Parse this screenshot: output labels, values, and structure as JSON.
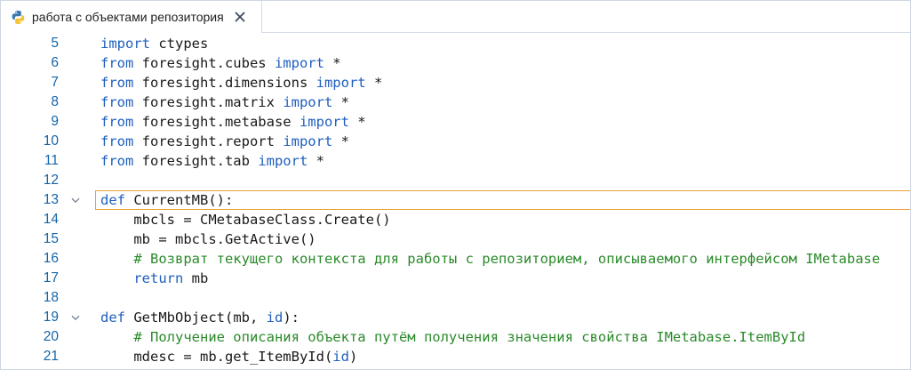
{
  "tab": {
    "title": "работа с объектами репозитория",
    "icon": "python-icon",
    "close_icon": "close-icon"
  },
  "colors": {
    "keyword": "#1f5fbf",
    "comment": "#2a8a2a",
    "line_number": "#1565a8",
    "current_line_border": "#e8a23a"
  },
  "editor": {
    "lines": [
      {
        "num": "5",
        "fold": false,
        "current": false,
        "tokens": [
          {
            "t": "kw",
            "v": "import"
          },
          {
            "t": "tx",
            "v": " ctypes"
          }
        ]
      },
      {
        "num": "6",
        "fold": false,
        "current": false,
        "tokens": [
          {
            "t": "kw",
            "v": "from"
          },
          {
            "t": "tx",
            "v": " foresight.cubes "
          },
          {
            "t": "kw",
            "v": "import"
          },
          {
            "t": "tx",
            "v": " *"
          }
        ]
      },
      {
        "num": "7",
        "fold": false,
        "current": false,
        "tokens": [
          {
            "t": "kw",
            "v": "from"
          },
          {
            "t": "tx",
            "v": " foresight.dimensions "
          },
          {
            "t": "kw",
            "v": "import"
          },
          {
            "t": "tx",
            "v": " *"
          }
        ]
      },
      {
        "num": "8",
        "fold": false,
        "current": false,
        "tokens": [
          {
            "t": "kw",
            "v": "from"
          },
          {
            "t": "tx",
            "v": " foresight.matrix "
          },
          {
            "t": "kw",
            "v": "import"
          },
          {
            "t": "tx",
            "v": " *"
          }
        ]
      },
      {
        "num": "9",
        "fold": false,
        "current": false,
        "tokens": [
          {
            "t": "kw",
            "v": "from"
          },
          {
            "t": "tx",
            "v": " foresight.metabase "
          },
          {
            "t": "kw",
            "v": "import"
          },
          {
            "t": "tx",
            "v": " *"
          }
        ]
      },
      {
        "num": "10",
        "fold": false,
        "current": false,
        "tokens": [
          {
            "t": "kw",
            "v": "from"
          },
          {
            "t": "tx",
            "v": " foresight.report "
          },
          {
            "t": "kw",
            "v": "import"
          },
          {
            "t": "tx",
            "v": " *"
          }
        ]
      },
      {
        "num": "11",
        "fold": false,
        "current": false,
        "tokens": [
          {
            "t": "kw",
            "v": "from"
          },
          {
            "t": "tx",
            "v": " foresight.tab "
          },
          {
            "t": "kw",
            "v": "import"
          },
          {
            "t": "tx",
            "v": " *"
          }
        ]
      },
      {
        "num": "12",
        "fold": false,
        "current": false,
        "tokens": []
      },
      {
        "num": "13",
        "fold": true,
        "current": true,
        "tokens": [
          {
            "t": "kw",
            "v": "def"
          },
          {
            "t": "tx",
            "v": " CurrentMB():"
          }
        ]
      },
      {
        "num": "14",
        "fold": false,
        "current": false,
        "tokens": [
          {
            "t": "tx",
            "v": "    mbcls = CMetabaseClass.Create()"
          }
        ]
      },
      {
        "num": "15",
        "fold": false,
        "current": false,
        "tokens": [
          {
            "t": "tx",
            "v": "    mb = mbcls.GetActive()"
          }
        ]
      },
      {
        "num": "16",
        "fold": false,
        "current": false,
        "tokens": [
          {
            "t": "tx",
            "v": "    "
          },
          {
            "t": "cm",
            "v": "# Возврат текущего контекста для работы с репозиторием, описываемого интерфейсом IMetabase"
          }
        ]
      },
      {
        "num": "17",
        "fold": false,
        "current": false,
        "tokens": [
          {
            "t": "tx",
            "v": "    "
          },
          {
            "t": "kw",
            "v": "return"
          },
          {
            "t": "tx",
            "v": " mb"
          }
        ]
      },
      {
        "num": "18",
        "fold": false,
        "current": false,
        "tokens": []
      },
      {
        "num": "19",
        "fold": true,
        "current": false,
        "tokens": [
          {
            "t": "kw",
            "v": "def"
          },
          {
            "t": "tx",
            "v": " GetMbObject(mb, "
          },
          {
            "t": "id",
            "v": "id"
          },
          {
            "t": "tx",
            "v": "):"
          }
        ]
      },
      {
        "num": "20",
        "fold": false,
        "current": false,
        "tokens": [
          {
            "t": "tx",
            "v": "    "
          },
          {
            "t": "cm",
            "v": "# Получение описания объекта путём получения значения свойства IMetabase.ItemById"
          }
        ]
      },
      {
        "num": "21",
        "fold": false,
        "current": false,
        "tokens": [
          {
            "t": "tx",
            "v": "    mdesc = mb.get_ItemById("
          },
          {
            "t": "id",
            "v": "id"
          },
          {
            "t": "tx",
            "v": ")"
          }
        ]
      }
    ]
  }
}
